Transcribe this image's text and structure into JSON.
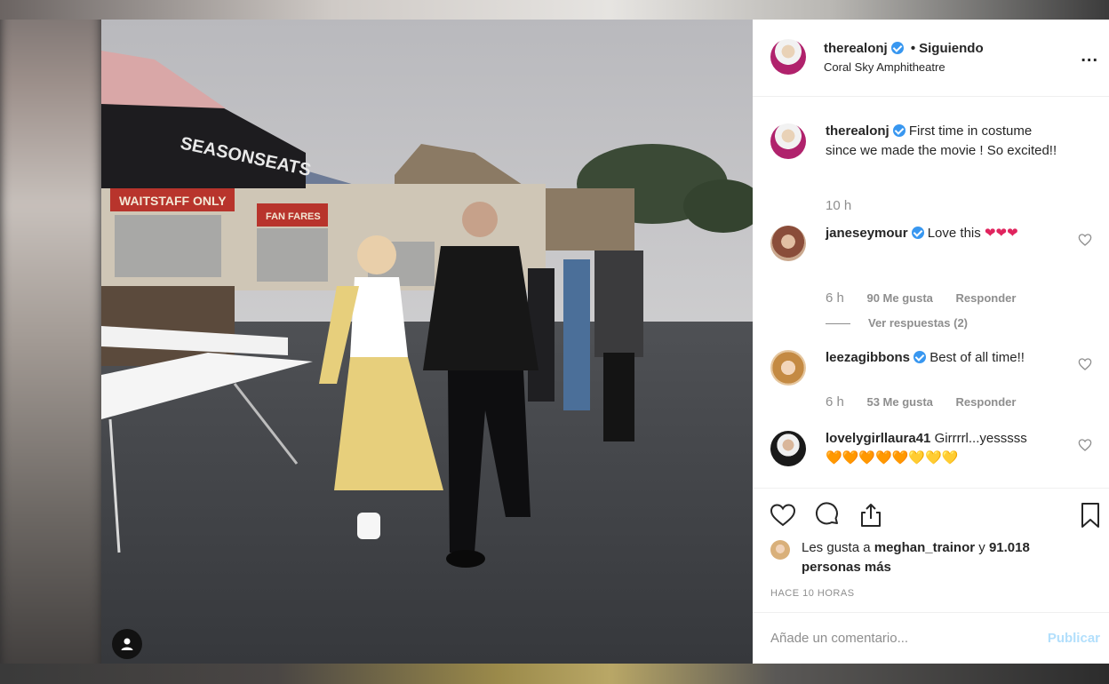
{
  "post": {
    "username": "therealonj",
    "follow_status": "Siguiendo",
    "separator": "•",
    "location": "Coral Sky Amphitheatre",
    "more_label": "..."
  },
  "photo": {
    "signs": {
      "tent": "SEASONSEATS",
      "waitstaff": "WAITSTAFF ONLY",
      "fanfare": "FAN FARES"
    },
    "colors": {
      "dress": "#e7cf7c",
      "jacket": "#171717",
      "sky": "#c9c9cc",
      "ground": "#3f4145"
    }
  },
  "caption": {
    "username": "therealonj",
    "text": "First time in costume since we made the movie ! So excited!!",
    "time": "10 h"
  },
  "comments": [
    {
      "username": "janeseymour",
      "text": "Love this",
      "emoji": "❤❤❤",
      "time": "6 h",
      "likes": "90 Me gusta",
      "reply": "Responder",
      "view_replies": "Ver respuestas (2)"
    },
    {
      "username": "leezagibbons",
      "text": "Best of all time!!",
      "time": "6 h",
      "likes": "53 Me gusta",
      "reply": "Responder"
    },
    {
      "username": "lovelygirllaura41",
      "text": "Girrrrl...yesssss",
      "emoji_orange": "🧡🧡🧡🧡🧡",
      "emoji_yellow": "💛💛💛"
    }
  ],
  "likes": {
    "prefix": "Les gusta a",
    "user": "meghan_trainor",
    "joiner": "y",
    "others": "91.018 personas más"
  },
  "timestamp": "HACE 10 HORAS",
  "compose": {
    "placeholder": "Añade un comentario...",
    "publish": "Publicar"
  },
  "theme": {
    "verified": "#3897f0",
    "muted": "#8e8e8e",
    "publish": "#b2dffc",
    "heart": "#ed4956"
  }
}
